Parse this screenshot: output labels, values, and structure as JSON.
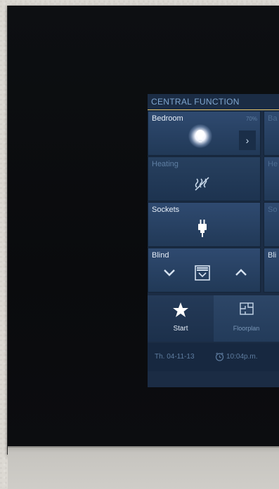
{
  "screen": {
    "title": "CENTRAL FUNCTION"
  },
  "tiles": [
    {
      "label": "Bedroom",
      "value": "70%",
      "icon": "lightbulb-icon",
      "action_icon": "chevron-right-icon"
    },
    {
      "label": "Heating",
      "icon": "heating-icon",
      "state": "inactive"
    },
    {
      "label": "Sockets",
      "icon": "plug-icon"
    },
    {
      "label": "Blind",
      "icons": [
        "chevron-down-icon",
        "blind-icon",
        "chevron-up-icon"
      ]
    }
  ],
  "partial_column": {
    "labels": [
      "Ba",
      "He",
      "So",
      "Bli"
    ]
  },
  "nav": {
    "start_label": "Start",
    "floorplan_label": "Floorplan"
  },
  "status": {
    "date": "Th. 04-11-13",
    "time": "10:04p.m."
  },
  "colors": {
    "accent_line": "#e8c76a",
    "tile": "#2f4a70",
    "screen_bg": "#1b2c44"
  }
}
